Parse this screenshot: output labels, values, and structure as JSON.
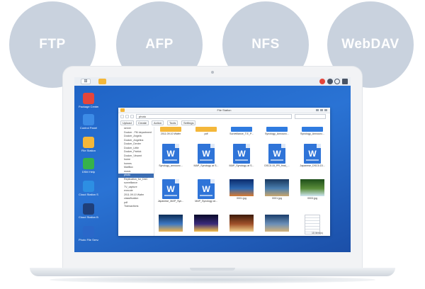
{
  "protocols": [
    "FTP",
    "AFP",
    "NFS",
    "WebDAV"
  ],
  "desktop_icons": [
    {
      "label": "Package Center",
      "color": "#e4453a"
    },
    {
      "label": "Control Panel",
      "color": "#3c8be6"
    },
    {
      "label": "File Station",
      "color": "#f4b73a"
    },
    {
      "label": "DSM Help",
      "color": "#36b24a"
    },
    {
      "label": "Cloud Station ShareSync",
      "color": "#2d8fe3"
    },
    {
      "label": "Cloud Station Backup",
      "color": "#1f3f7a"
    },
    {
      "label": "Photo File Server",
      "color": "#2a67c9"
    }
  ],
  "window": {
    "title": "File Station",
    "path": "photo",
    "toolbar": [
      "Upload",
      "Create",
      "Action",
      "Tools",
      "Settings"
    ],
    "status": "15 item(s)"
  },
  "sidebar": [
    {
      "label": "server",
      "selected": false
    },
    {
      "label": "Docker - FM department",
      "selected": false
    },
    {
      "label": "Docker_Angela",
      "selected": false
    },
    {
      "label": "Docker_Angelina",
      "selected": false
    },
    {
      "label": "Docker_Dexter",
      "selected": false
    },
    {
      "label": "Docker_Little",
      "selected": false
    },
    {
      "label": "Docker_Patrick",
      "selected": false
    },
    {
      "label": "Docker_Vincent",
      "selected": false
    },
    {
      "label": "home",
      "selected": false
    },
    {
      "label": "homes",
      "selected": false
    },
    {
      "label": "MailBox",
      "selected": false
    },
    {
      "label": "music",
      "selected": false
    },
    {
      "label": "photo",
      "selected": true
    },
    {
      "label": "Replication_for_DAC",
      "selected": false
    },
    {
      "label": "surveillance",
      "selected": false
    },
    {
      "label": "TV_capture",
      "selected": false
    },
    {
      "label": "execute",
      "selected": false
    },
    {
      "label": "2011.09.10 Wafer",
      "selected": false
    },
    {
      "label": "classification",
      "selected": false
    },
    {
      "label": "pdf",
      "selected": false
    },
    {
      "label": "Transactions",
      "selected": false
    }
  ],
  "files": [
    {
      "type": "folder",
      "color": "#f4b73a",
      "name": "2011.09.10 Wafer"
    },
    {
      "type": "folder",
      "color": "#f4b73a",
      "name": "pdf"
    },
    {
      "type": "folder",
      "color": "#2f7be0",
      "name": "Surveillance_T.E_P..."
    },
    {
      "type": "folder",
      "color": "#2f7be0",
      "name": "Synology_Announc..."
    },
    {
      "type": "folder",
      "color": "#2f7be0",
      "name": "Synology_Announc..."
    },
    {
      "type": "doc",
      "name": "Synology_announc..."
    },
    {
      "type": "doc",
      "name": "MAP_Synology at S..."
    },
    {
      "type": "doc",
      "name": "MAP_Synology at S..."
    },
    {
      "type": "doc",
      "name": "DSC5.15_PR_final_..."
    },
    {
      "type": "doc",
      "name": "Japanese_DSC5.15..."
    },
    {
      "type": "doc",
      "name": "Japanese_MAP_Syn..."
    },
    {
      "type": "doc",
      "name": "MAP_Synology at..."
    },
    {
      "type": "photo",
      "colors": [
        "#0b2a6b",
        "#2d69b3",
        "#d97a2f"
      ],
      "name": "0001.jpg"
    },
    {
      "type": "photo",
      "colors": [
        "#17365c",
        "#4b7fb0",
        "#c9a66b"
      ],
      "name": "0001.jpg"
    },
    {
      "type": "photo",
      "colors": [
        "#1d4d1a",
        "#5a8d3a",
        "#cfe6f2"
      ],
      "name": "0003.jpg"
    },
    {
      "type": "photo",
      "colors": [
        "#0b2b55",
        "#3d78c2",
        "#f0b44a"
      ],
      "name": ""
    },
    {
      "type": "photo",
      "colors": [
        "#0a0a2a",
        "#3a2a7a",
        "#f5c04a"
      ],
      "name": ""
    },
    {
      "type": "photo",
      "colors": [
        "#3b1a0a",
        "#a0512a",
        "#f0d08a"
      ],
      "name": ""
    },
    {
      "type": "photo",
      "colors": [
        "#1a3d6a",
        "#6a8fb8",
        "#d6b47a"
      ],
      "name": ""
    },
    {
      "type": "text",
      "name": ""
    }
  ]
}
